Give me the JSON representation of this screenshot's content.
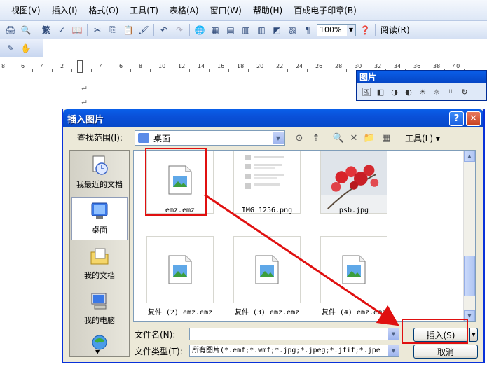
{
  "word": {
    "menu": [
      "视图(V)",
      "插入(I)",
      "格式(O)",
      "工具(T)",
      "表格(A)",
      "窗口(W)",
      "帮助(H)",
      "百成电子印章(B)"
    ],
    "zoom_value": "100%",
    "read_label": "阅读(R)",
    "ruler_numbers": [
      "8",
      "6",
      "4",
      "2",
      "2",
      "4",
      "6",
      "8",
      "10",
      "12",
      "14",
      "16",
      "18",
      "20",
      "22",
      "24",
      "26",
      "28",
      "30",
      "32",
      "34",
      "36",
      "38",
      "40"
    ],
    "para_mark": "↵",
    "picture_toolbar_title": "图片"
  },
  "dialog": {
    "title": "插入图片",
    "help_glyph": "?",
    "close_glyph": "✕",
    "lookin_label": "查找范围(I):",
    "lookin_value": "桌面",
    "tools_label": "工具(L) ▾",
    "places": [
      {
        "label": "我最近的文档"
      },
      {
        "label": "桌面"
      },
      {
        "label": "我的文档"
      },
      {
        "label": "我的电脑"
      }
    ],
    "files": [
      {
        "name": "emz.emz"
      },
      {
        "name": "IMG_1256.png"
      },
      {
        "name": "psb.jpg"
      },
      {
        "name": "复件 (2) emz.emz"
      },
      {
        "name": "复件 (3) emz.emz"
      },
      {
        "name": "复件 (4) emz.emz"
      }
    ],
    "filename_label": "文件名(N):",
    "filename_value": "",
    "filetype_label": "文件类型(T):",
    "filetype_value": "所有图片(*.emf;*.wmf;*.jpg;*.jpeg;*.jfif;*.jpe",
    "insert_label": "插入(S)",
    "cancel_label": "取消"
  },
  "colors": {
    "titlebar": "#0a54dc",
    "annotation": "#e01010",
    "dialog_bg": "#ece9d8"
  }
}
